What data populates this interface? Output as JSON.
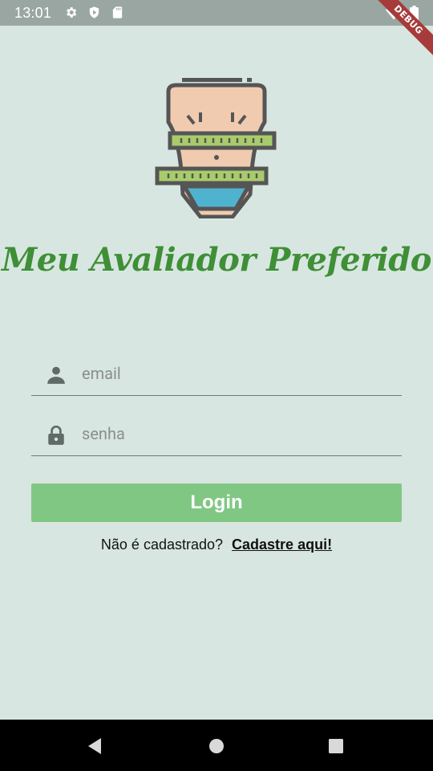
{
  "status_bar": {
    "time": "13:01"
  },
  "debug_banner": {
    "label": "DEBUG"
  },
  "app": {
    "title": "Meu Avaliador Preferido"
  },
  "form": {
    "email": {
      "placeholder": "email",
      "value": ""
    },
    "password": {
      "placeholder": "senha",
      "value": ""
    },
    "login_label": "Login"
  },
  "signup": {
    "prompt": "Não é cadastrado?",
    "link_label": "Cadastre aqui!"
  },
  "icons": {
    "status": [
      "settings-icon",
      "shield-icon",
      "sd-card-icon",
      "wifi-icon",
      "battery-icon"
    ],
    "email": "person-icon",
    "password": "lock-icon",
    "nav": [
      "back-icon",
      "home-icon",
      "recents-icon"
    ]
  },
  "colors": {
    "background": "#d8e6e1",
    "title": "#3f8f36",
    "login_button": "#81c784",
    "status_bar": "#9aa6a2"
  }
}
